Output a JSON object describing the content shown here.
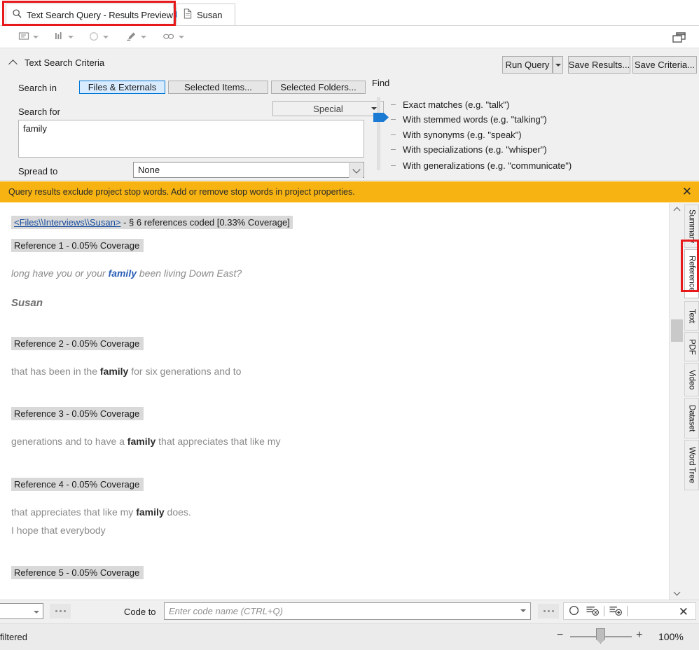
{
  "window": {
    "tabs": [
      {
        "label": "Text Search Query - Results Preview",
        "icon": "search-icon",
        "close": "✖",
        "active": true
      },
      {
        "label": "Susan",
        "icon": "document-icon",
        "active": false
      }
    ],
    "cascade_icon": "cascade-windows-icon"
  },
  "toolbar": {
    "items": [
      {
        "name": "annotation-icon",
        "caret": true
      },
      {
        "name": "coding-stripes-icon",
        "caret": true
      },
      {
        "name": "highlight-circle-icon",
        "caret": true
      },
      {
        "name": "highlighter-icon",
        "caret": true
      },
      {
        "name": "link-icon",
        "caret": true
      }
    ]
  },
  "criteria": {
    "title": "Text Search Criteria",
    "collapse_icon": "chevron-up-icon",
    "run_query_label": "Run Query",
    "save_results_label": "Save Results...",
    "save_criteria_label": "Save Criteria...",
    "search_in_label": "Search in",
    "search_in_buttons": [
      {
        "label": "Files & Externals",
        "selected": true
      },
      {
        "label": "Selected Items...",
        "selected": false
      },
      {
        "label": "Selected Folders...",
        "selected": false
      }
    ],
    "search_for_label": "Search for",
    "search_for_value": "family",
    "search_for_placeholder": "",
    "special_label": "Special",
    "spread_to_label": "Spread to",
    "spread_to_value": "None",
    "find_label": "Find",
    "find_options": [
      {
        "label": "Exact matches (e.g. \"talk\")",
        "selected": false
      },
      {
        "label": "With stemmed words (e.g. \"talking\")",
        "selected": true
      },
      {
        "label": "With synonyms (e.g. \"speak\")",
        "selected": false
      },
      {
        "label": "With specializations (e.g. \"whisper\")",
        "selected": false
      },
      {
        "label": "With generalizations (e.g. \"communicate\")",
        "selected": false
      }
    ]
  },
  "warning": {
    "message": "Query results exclude project stop words. Add or remove stop words in project properties.",
    "close": "✕",
    "color": "#f6b311"
  },
  "results": {
    "source_link": "<Files\\\\Interviews\\\\Susan>",
    "source_meta": " - § 6 references coded  [0.33% Coverage]",
    "references": [
      {
        "label": "Reference 1 - 0.05% Coverage",
        "style": "italic",
        "pre": "long have you or your ",
        "hit": "family",
        "post": " been living Down East?",
        "speaker": "Susan"
      },
      {
        "label": "Reference 2 - 0.05% Coverage",
        "style": "normal",
        "pre": "that has been in the ",
        "hit": "family",
        "post": " for six generations and to",
        "speaker": ""
      },
      {
        "label": "Reference 3 - 0.05% Coverage",
        "style": "normal",
        "pre": "generations and to have a ",
        "hit": "family",
        "post": " that appreciates that like my",
        "speaker": ""
      },
      {
        "label": "Reference 4 - 0.05% Coverage",
        "style": "normal",
        "pre": "that appreciates that like my ",
        "hit": "family",
        "post": " does.",
        "line2": "I hope that everybody",
        "speaker": ""
      },
      {
        "label": "Reference 5 - 0.05% Coverage",
        "style": "normal",
        "pre": "",
        "hit": "",
        "post": "",
        "speaker": ""
      }
    ]
  },
  "side_tabs": [
    {
      "label": "Summary",
      "active": false
    },
    {
      "label": "Reference",
      "active": true
    },
    {
      "label": "Text",
      "active": false
    },
    {
      "label": "PDF",
      "active": false
    },
    {
      "label": "Video",
      "active": false
    },
    {
      "label": "Dataset",
      "active": false
    },
    {
      "label": "Word Tree",
      "active": false
    }
  ],
  "bottom": {
    "code_to_label": "Code to",
    "code_to_placeholder": "Enter code name (CTRL+Q)",
    "ellipsis": "•••",
    "close": "✕"
  },
  "status": {
    "text": "filtered",
    "zoom_minus": "−",
    "zoom_plus": "+",
    "zoom_percent": "100%"
  },
  "accents": {
    "selected_blue": "#0078d7",
    "selected_blue_bg": "#d9ecff",
    "link_blue": "#1a4fa0",
    "warn_yellow": "#f6b311",
    "annotation_red": "#e8191b"
  }
}
